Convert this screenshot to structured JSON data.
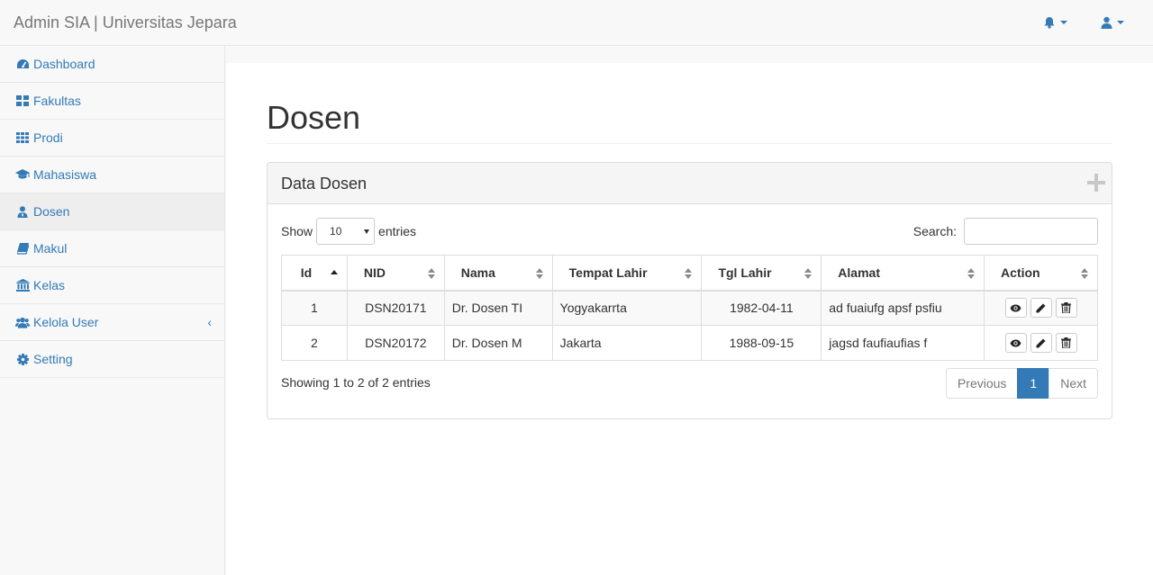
{
  "app": {
    "brand": "Admin SIA | Universitas Jepara",
    "accent": "#337ab7"
  },
  "navbar": {
    "notifications_icon": "bell-icon",
    "user_icon": "user-icon"
  },
  "sidebar": {
    "items": [
      {
        "label": "Dashboard",
        "icon": "dashboard-icon"
      },
      {
        "label": "Fakultas",
        "icon": "th-large-icon"
      },
      {
        "label": "Prodi",
        "icon": "th-icon"
      },
      {
        "label": "Mahasiswa",
        "icon": "graduation-cap-icon"
      },
      {
        "label": "Dosen",
        "icon": "user-tie-icon",
        "active": true
      },
      {
        "label": "Makul",
        "icon": "book-icon"
      },
      {
        "label": "Kelas",
        "icon": "institution-icon"
      },
      {
        "label": "Kelola User",
        "icon": "users-icon",
        "has_submenu": true
      },
      {
        "label": "Setting",
        "icon": "gear-icon"
      }
    ]
  },
  "main": {
    "page_title": "Dosen",
    "panel_title": "Data Dosen",
    "show_label": "Show",
    "entries_label": "entries",
    "page_length": "10",
    "search_label": "Search:",
    "search_value": "",
    "table": {
      "columns": [
        "Id",
        "NID",
        "Nama",
        "Tempat Lahir",
        "Tgl Lahir",
        "Alamat",
        "Action"
      ],
      "rows": [
        {
          "id": "1",
          "nid": "DSN20171",
          "nama": "Dr. Dosen TI",
          "tempat_lahir": "Yogyakarrta",
          "tgl_lahir": "1982-04-11",
          "alamat": "ad fuaiufg apsf psfiu"
        },
        {
          "id": "2",
          "nid": "DSN20172",
          "nama": "Dr. Dosen M",
          "tempat_lahir": "Jakarta",
          "tgl_lahir": "1988-09-15",
          "alamat": "jagsd faufiaufias f"
        }
      ]
    },
    "info": "Showing 1 to 2 of 2 entries",
    "pagination": {
      "previous": "Previous",
      "current": "1",
      "next": "Next"
    }
  }
}
